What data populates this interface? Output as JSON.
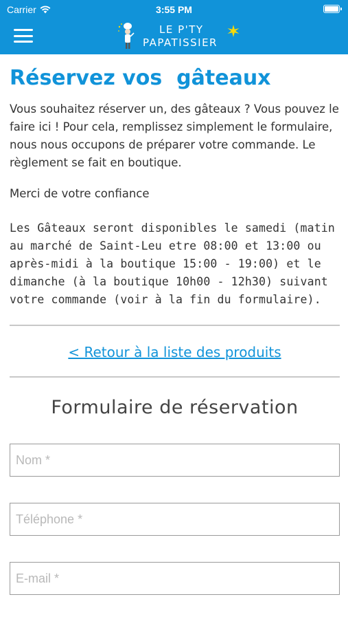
{
  "status_bar": {
    "carrier": "Carrier",
    "time": "3:55 PM"
  },
  "header": {
    "logo_line1": "LE P'TY",
    "logo_line2": "PAPATISSIER",
    "bar_color": "#1193d9",
    "star_color": "#f5d90a"
  },
  "main": {
    "title": "Réservez vos  gâteaux",
    "intro": "Vous souhaitez réserver un, des gâteaux ? Vous pouvez le faire ici ! Pour cela, remplissez simplement le formulaire, nous nous occupons de préparer votre commande. Le règlement se fait en boutique.",
    "thanks": "Merci de votre confiance",
    "availability": "Les Gâteaux seront disponibles le samedi (matin au marché de Saint-Leu etre 08:00 et 13:00 ou après-midi à la boutique 15:00 - 19:00) et le dimanche (à la boutique 10h00 - 12h30) suivant votre commande (voir à la fin du formulaire).",
    "back_link": "< Retour à la liste des produits"
  },
  "form": {
    "title": "Formulaire de réservation",
    "fields": [
      {
        "placeholder": "Nom *",
        "value": ""
      },
      {
        "placeholder": "Téléphone *",
        "value": ""
      },
      {
        "placeholder": "E-mail *",
        "value": ""
      }
    ]
  }
}
